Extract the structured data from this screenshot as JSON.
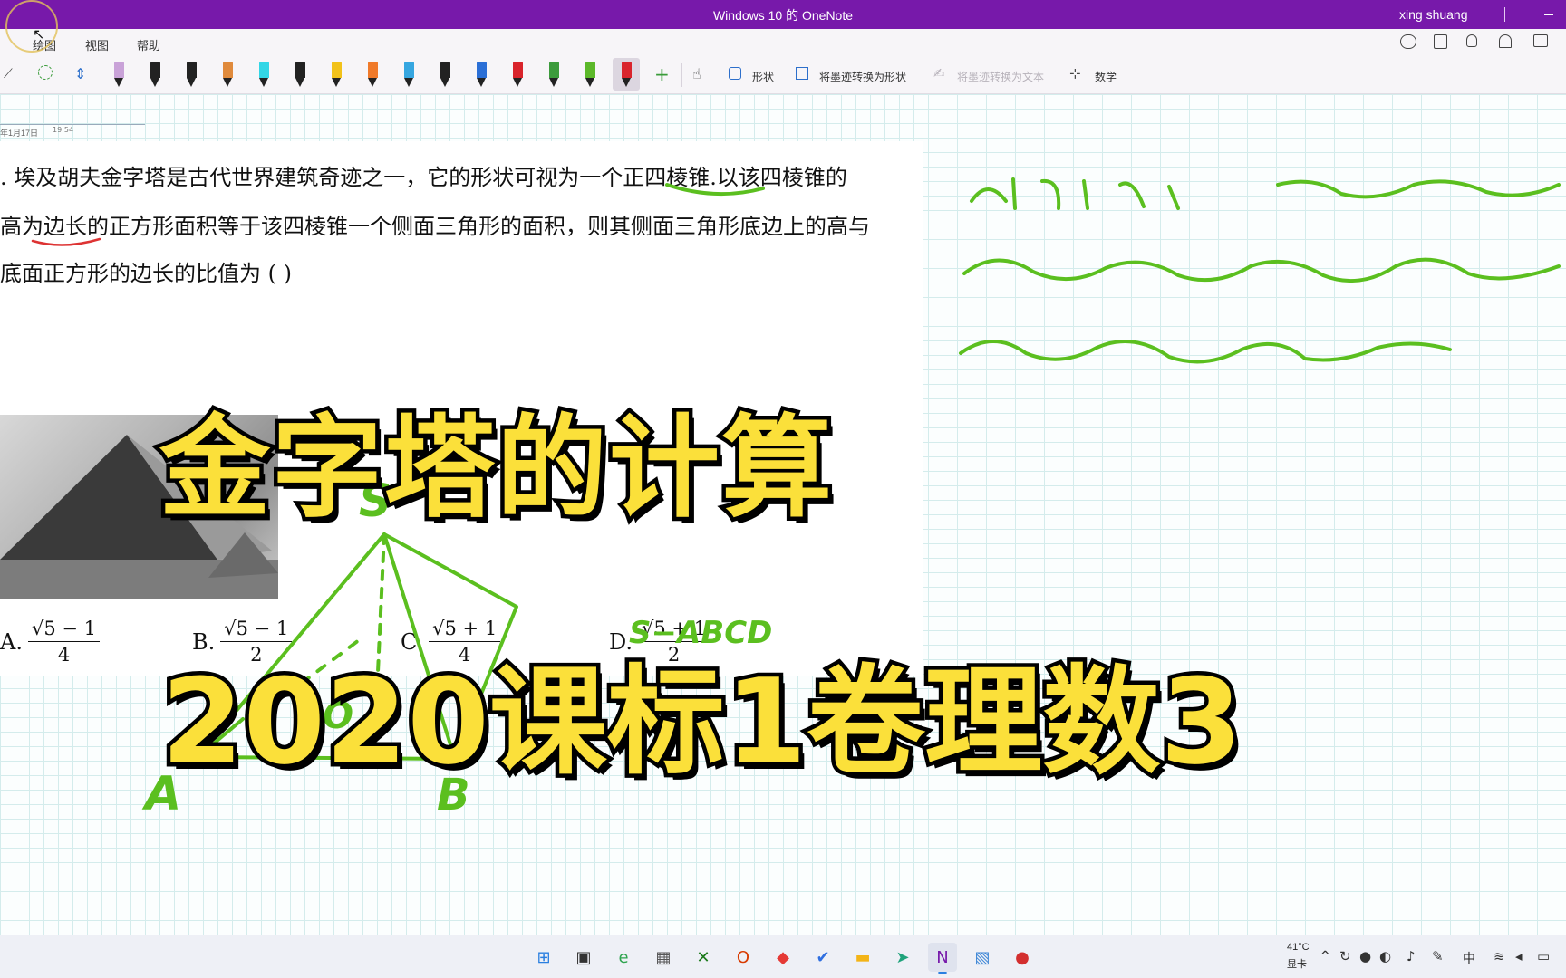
{
  "window": {
    "title": "Windows 10 的 OneNote",
    "user": "xing shuang"
  },
  "menu": {
    "tabs": [
      {
        "label": "绘图",
        "active": true
      },
      {
        "label": "视图",
        "active": false
      },
      {
        "label": "帮助",
        "active": false
      }
    ]
  },
  "toolbar": {
    "shapes_label": "形状",
    "ink_to_shape_label": "将墨迹转换为形状",
    "ink_to_text_label": "将墨迹转换为文本",
    "math_label": "数学",
    "pens": [
      {
        "color": "#c9a2d8",
        "icon": "highlighter-icon"
      },
      {
        "color": "#222222",
        "icon": "pen-icon"
      },
      {
        "color": "#222222",
        "icon": "pen-icon"
      },
      {
        "color": "#e08a3c",
        "icon": "pen-icon"
      },
      {
        "color": "#33d6e6",
        "icon": "highlighter-icon"
      },
      {
        "color": "#222222",
        "icon": "pen-icon"
      },
      {
        "color": "#f2c21a",
        "icon": "pen-icon"
      },
      {
        "color": "#f07a2a",
        "icon": "pen-icon"
      },
      {
        "color": "#36a6e0",
        "icon": "pen-icon"
      },
      {
        "color": "#222222",
        "icon": "pen-icon"
      },
      {
        "color": "#2b6fd6",
        "icon": "pen-icon"
      },
      {
        "color": "#d9242c",
        "icon": "pen-icon"
      },
      {
        "color": "#3c9b3c",
        "icon": "pen-icon"
      },
      {
        "color": "#5cb82a",
        "icon": "pen-icon"
      },
      {
        "color": "#d9242c",
        "icon": "pen-icon",
        "selected": true
      }
    ]
  },
  "note": {
    "date": "年1月17日",
    "time": "19:54"
  },
  "problem": {
    "lines": [
      ". 埃及胡夫金字塔是古代世界建筑奇迹之一，它的形状可视为一个正四棱锥.以该四棱锥的",
      "高为边长的正方形面积等于该四棱锥一个侧面三角形的面积，则其侧面三角形底边上的高与",
      "底面正方形的边长的比值为 (    )"
    ],
    "choices": [
      {
        "letter": "A.",
        "numerator": "√5 − 1",
        "denominator": "4"
      },
      {
        "letter": "B.",
        "numerator": "√5 − 1",
        "denominator": "2"
      },
      {
        "letter": "C.",
        "numerator": "√5 + 1",
        "denominator": "4"
      },
      {
        "letter": "D.",
        "numerator": "√5 + 1",
        "denominator": "2"
      }
    ]
  },
  "overlay": {
    "title_top": "金字塔的计算",
    "title_bottom": "2020课标1卷理数3"
  },
  "handwriting": {
    "vertex": "S",
    "solid_name": "S−ABCD",
    "foot": "O",
    "point_a": "A",
    "point_b": "B",
    "ink_color": "#5bbf1f"
  },
  "taskbar": {
    "apps": [
      {
        "icon": "start-icon"
      },
      {
        "icon": "task-view-icon"
      },
      {
        "icon": "edge-icon"
      },
      {
        "icon": "calculator-icon"
      },
      {
        "icon": "xbox-icon"
      },
      {
        "icon": "office-icon"
      },
      {
        "icon": "app-red-icon"
      },
      {
        "icon": "app-blue-icon"
      },
      {
        "icon": "file-explorer-icon"
      },
      {
        "icon": "app-green-icon"
      },
      {
        "icon": "onenote-icon",
        "active": true
      },
      {
        "icon": "photos-icon"
      },
      {
        "icon": "recorder-icon"
      }
    ],
    "temperature": "41°C",
    "gpu_label": "显卡",
    "ime": "中"
  }
}
